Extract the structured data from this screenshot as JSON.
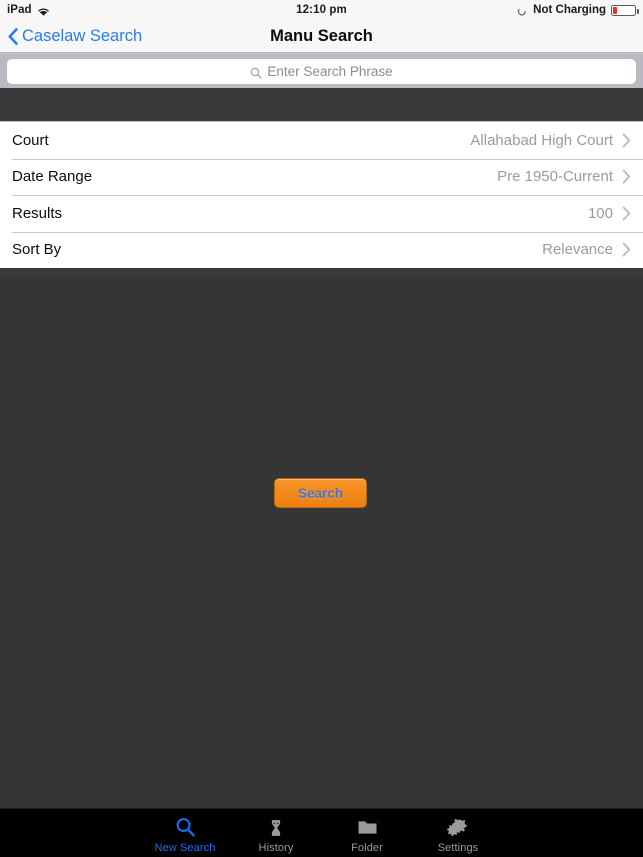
{
  "status_bar": {
    "device": "iPad",
    "wifi_icon": "wifi-icon",
    "time": "12:10 pm",
    "charging_icon": "charging-indicator-icon",
    "charging_text": "Not Charging",
    "battery_icon": "battery-low-icon",
    "battery_color": "#e8322a"
  },
  "nav_bar": {
    "back_icon": "chevron-left-icon",
    "back_label": "Caselaw Search",
    "title": "Manu Search",
    "tint_color": "#2a7bf0"
  },
  "search": {
    "icon": "search-icon",
    "value": "",
    "placeholder": "Enter Search Phrase"
  },
  "options": {
    "rows": [
      {
        "label": "Court",
        "value": "Allahabad High Court",
        "accessory": "chevron-right-icon"
      },
      {
        "label": "Date Range",
        "value": "Pre 1950-Current",
        "accessory": "chevron-right-icon"
      },
      {
        "label": "Results",
        "value": "100",
        "accessory": "chevron-right-icon"
      },
      {
        "label": "Sort By",
        "value": "Relevance",
        "accessory": "chevron-right-icon"
      }
    ]
  },
  "main": {
    "search_button_label": "Search",
    "search_button_color": "#f0860f",
    "search_button_text_color": "#4276d4",
    "background_color": "#353535"
  },
  "tab_bar": {
    "active_color": "#1a6ef0",
    "inactive_color": "#9a9a9a",
    "tabs": [
      {
        "label": "New Search",
        "icon": "search-icon",
        "active": true
      },
      {
        "label": "History",
        "icon": "hourglass-icon",
        "active": false
      },
      {
        "label": "Folder",
        "icon": "folder-icon",
        "active": false
      },
      {
        "label": "Settings",
        "icon": "gears-icon",
        "active": false
      }
    ]
  }
}
